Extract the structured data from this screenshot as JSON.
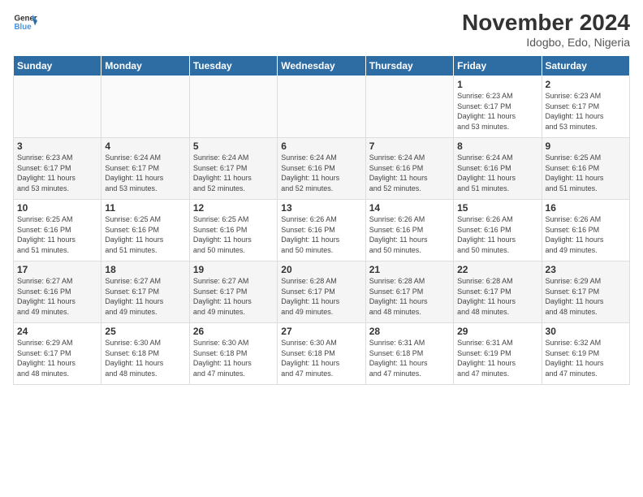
{
  "logo": {
    "line1": "General",
    "line2": "Blue"
  },
  "title": "November 2024",
  "subtitle": "Idogbo, Edo, Nigeria",
  "days_of_week": [
    "Sunday",
    "Monday",
    "Tuesday",
    "Wednesday",
    "Thursday",
    "Friday",
    "Saturday"
  ],
  "weeks": [
    [
      {
        "day": "",
        "info": ""
      },
      {
        "day": "",
        "info": ""
      },
      {
        "day": "",
        "info": ""
      },
      {
        "day": "",
        "info": ""
      },
      {
        "day": "",
        "info": ""
      },
      {
        "day": "1",
        "info": "Sunrise: 6:23 AM\nSunset: 6:17 PM\nDaylight: 11 hours\nand 53 minutes."
      },
      {
        "day": "2",
        "info": "Sunrise: 6:23 AM\nSunset: 6:17 PM\nDaylight: 11 hours\nand 53 minutes."
      }
    ],
    [
      {
        "day": "3",
        "info": "Sunrise: 6:23 AM\nSunset: 6:17 PM\nDaylight: 11 hours\nand 53 minutes."
      },
      {
        "day": "4",
        "info": "Sunrise: 6:24 AM\nSunset: 6:17 PM\nDaylight: 11 hours\nand 53 minutes."
      },
      {
        "day": "5",
        "info": "Sunrise: 6:24 AM\nSunset: 6:17 PM\nDaylight: 11 hours\nand 52 minutes."
      },
      {
        "day": "6",
        "info": "Sunrise: 6:24 AM\nSunset: 6:16 PM\nDaylight: 11 hours\nand 52 minutes."
      },
      {
        "day": "7",
        "info": "Sunrise: 6:24 AM\nSunset: 6:16 PM\nDaylight: 11 hours\nand 52 minutes."
      },
      {
        "day": "8",
        "info": "Sunrise: 6:24 AM\nSunset: 6:16 PM\nDaylight: 11 hours\nand 51 minutes."
      },
      {
        "day": "9",
        "info": "Sunrise: 6:25 AM\nSunset: 6:16 PM\nDaylight: 11 hours\nand 51 minutes."
      }
    ],
    [
      {
        "day": "10",
        "info": "Sunrise: 6:25 AM\nSunset: 6:16 PM\nDaylight: 11 hours\nand 51 minutes."
      },
      {
        "day": "11",
        "info": "Sunrise: 6:25 AM\nSunset: 6:16 PM\nDaylight: 11 hours\nand 51 minutes."
      },
      {
        "day": "12",
        "info": "Sunrise: 6:25 AM\nSunset: 6:16 PM\nDaylight: 11 hours\nand 50 minutes."
      },
      {
        "day": "13",
        "info": "Sunrise: 6:26 AM\nSunset: 6:16 PM\nDaylight: 11 hours\nand 50 minutes."
      },
      {
        "day": "14",
        "info": "Sunrise: 6:26 AM\nSunset: 6:16 PM\nDaylight: 11 hours\nand 50 minutes."
      },
      {
        "day": "15",
        "info": "Sunrise: 6:26 AM\nSunset: 6:16 PM\nDaylight: 11 hours\nand 50 minutes."
      },
      {
        "day": "16",
        "info": "Sunrise: 6:26 AM\nSunset: 6:16 PM\nDaylight: 11 hours\nand 49 minutes."
      }
    ],
    [
      {
        "day": "17",
        "info": "Sunrise: 6:27 AM\nSunset: 6:16 PM\nDaylight: 11 hours\nand 49 minutes."
      },
      {
        "day": "18",
        "info": "Sunrise: 6:27 AM\nSunset: 6:17 PM\nDaylight: 11 hours\nand 49 minutes."
      },
      {
        "day": "19",
        "info": "Sunrise: 6:27 AM\nSunset: 6:17 PM\nDaylight: 11 hours\nand 49 minutes."
      },
      {
        "day": "20",
        "info": "Sunrise: 6:28 AM\nSunset: 6:17 PM\nDaylight: 11 hours\nand 49 minutes."
      },
      {
        "day": "21",
        "info": "Sunrise: 6:28 AM\nSunset: 6:17 PM\nDaylight: 11 hours\nand 48 minutes."
      },
      {
        "day": "22",
        "info": "Sunrise: 6:28 AM\nSunset: 6:17 PM\nDaylight: 11 hours\nand 48 minutes."
      },
      {
        "day": "23",
        "info": "Sunrise: 6:29 AM\nSunset: 6:17 PM\nDaylight: 11 hours\nand 48 minutes."
      }
    ],
    [
      {
        "day": "24",
        "info": "Sunrise: 6:29 AM\nSunset: 6:17 PM\nDaylight: 11 hours\nand 48 minutes."
      },
      {
        "day": "25",
        "info": "Sunrise: 6:30 AM\nSunset: 6:18 PM\nDaylight: 11 hours\nand 48 minutes."
      },
      {
        "day": "26",
        "info": "Sunrise: 6:30 AM\nSunset: 6:18 PM\nDaylight: 11 hours\nand 47 minutes."
      },
      {
        "day": "27",
        "info": "Sunrise: 6:30 AM\nSunset: 6:18 PM\nDaylight: 11 hours\nand 47 minutes."
      },
      {
        "day": "28",
        "info": "Sunrise: 6:31 AM\nSunset: 6:18 PM\nDaylight: 11 hours\nand 47 minutes."
      },
      {
        "day": "29",
        "info": "Sunrise: 6:31 AM\nSunset: 6:19 PM\nDaylight: 11 hours\nand 47 minutes."
      },
      {
        "day": "30",
        "info": "Sunrise: 6:32 AM\nSunset: 6:19 PM\nDaylight: 11 hours\nand 47 minutes."
      }
    ]
  ]
}
